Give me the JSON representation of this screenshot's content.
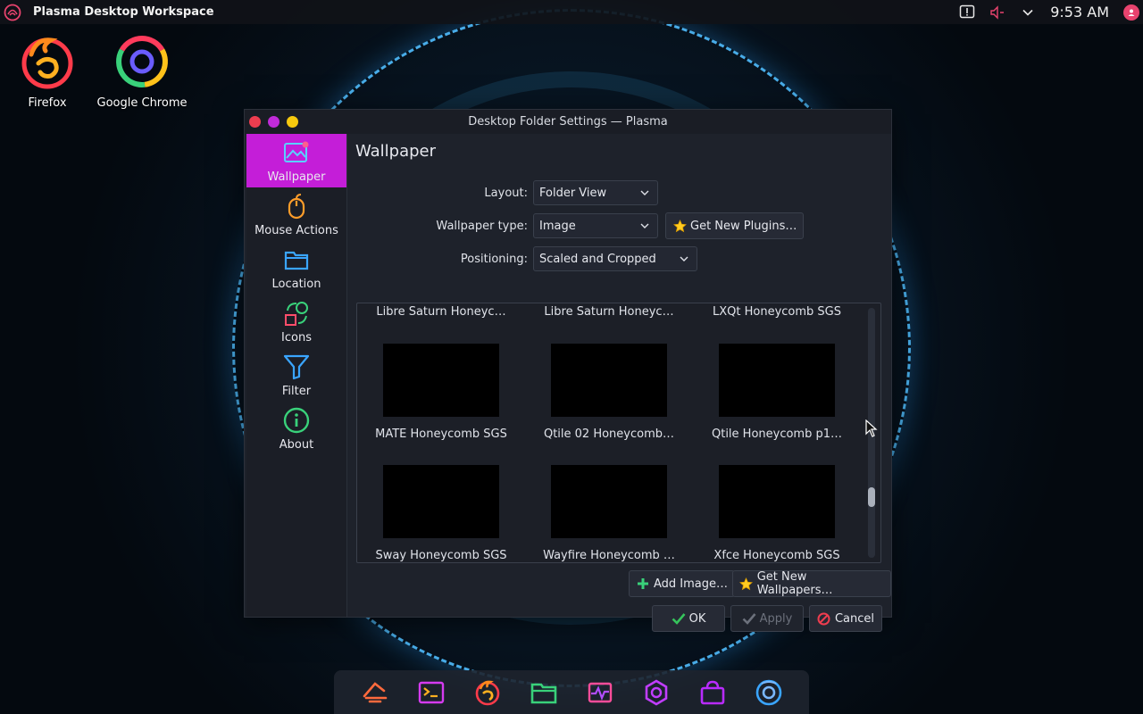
{
  "top_panel": {
    "title": "Plasma Desktop Workspace",
    "clock": "9:53 AM",
    "icons": [
      "kde-logo-icon",
      "notification-alert-icon",
      "volume-muted-icon",
      "chevron-down-icon",
      "user-avatar-icon"
    ]
  },
  "desktop": {
    "icons": [
      {
        "label": "Firefox",
        "icon": "firefox-icon"
      },
      {
        "label": "Google Chrome",
        "icon": "chrome-icon"
      }
    ]
  },
  "dialog": {
    "title": "Desktop Folder Settings — Plasma",
    "sidebar": [
      {
        "label": "Wallpaper",
        "icon": "wallpaper-icon",
        "active": true
      },
      {
        "label": "Mouse Actions",
        "icon": "mouse-icon"
      },
      {
        "label": "Location",
        "icon": "folder-icon"
      },
      {
        "label": "Icons",
        "icon": "icons-icon"
      },
      {
        "label": "Filter",
        "icon": "filter-icon"
      },
      {
        "label": "About",
        "icon": "info-icon"
      }
    ],
    "page_title": "Wallpaper",
    "form": {
      "layout_label": "Layout:",
      "layout_value": "Folder View",
      "wallpaper_type_label": "Wallpaper type:",
      "wallpaper_type_value": "Image",
      "get_plugins_label": "Get New Plugins…",
      "positioning_label": "Positioning:",
      "positioning_value": "Scaled and Cropped"
    },
    "wallpapers": {
      "top_row_labels": [
        "Libre Saturn Honeyc…",
        "Libre Saturn Honeyc…",
        "LXQt Honeycomb SGS"
      ],
      "row1_labels": [
        "MATE Honeycomb SGS",
        "Qtile 02 Honeycomb…",
        "Qtile Honeycomb p1…"
      ],
      "row2_labels": [
        "Sway Honeycomb SGS",
        "Wayfire Honeycomb …",
        "Xfce Honeycomb SGS"
      ],
      "scroll_position": 0.78
    },
    "add_image_label": "Add Image…",
    "get_wallpapers_label": "Get New Wallpapers…",
    "ok_label": "OK",
    "apply_label": "Apply",
    "cancel_label": "Cancel"
  },
  "dock": {
    "items": [
      "app-launcher-icon",
      "terminal-icon",
      "firefox-icon",
      "files-icon",
      "system-monitor-icon",
      "settings-icon",
      "store-icon",
      "browser-icon"
    ]
  },
  "colors": {
    "accent": "#c41ed8",
    "dialog_bg": "#1e222b",
    "ok_check": "#36c45c",
    "cancel_red": "#ee3d4f"
  }
}
